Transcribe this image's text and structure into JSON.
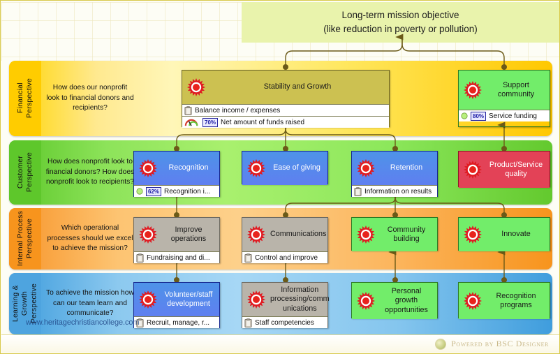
{
  "mission": {
    "line1": "Long-term mission objective",
    "line2": "(like reduction in poverty or pollution)"
  },
  "perspectives": [
    {
      "id": "financial",
      "label": "Financial\nPerspective",
      "color": "#ffcc00",
      "question": "How does our nonprofit look to financial donors and recipients?"
    },
    {
      "id": "customer",
      "label": "Customer\nPerspective",
      "color": "#5ec72b",
      "question": "How does nonprofit look to financial donors? How does nonprofit look to recipients?"
    },
    {
      "id": "internal",
      "label": "Internal Process\nPerspective",
      "color": "#f7941d",
      "question": "Which operational processes should we excel to achieve the mission?"
    },
    {
      "id": "learning",
      "label": "Learning &\nGrowth\nPerspective",
      "color": "#4ea4df",
      "question": "To achieve the mission how can our team learn and communicate?"
    }
  ],
  "objectives": [
    {
      "id": "stability-and-growth",
      "title": "Stability and Growth",
      "perspective": "financial",
      "kpis": [
        {
          "icon": "document-icon",
          "percent": null,
          "text": "Balance income / expenses"
        },
        {
          "icon": "gauge-icon",
          "percent": "70%",
          "text": "Net amount of funds raised"
        }
      ]
    },
    {
      "id": "support-community",
      "title": "Support community",
      "perspective": "financial",
      "kpis": [
        {
          "icon": "status-circle-icon",
          "percent": "80%",
          "text": "Service funding"
        }
      ]
    },
    {
      "id": "recognition",
      "title": "Recognition",
      "perspective": "customer",
      "kpis": [
        {
          "icon": "status-circle-icon",
          "percent": "62%",
          "text": "Recognition i..."
        }
      ]
    },
    {
      "id": "ease-of-giving",
      "title": "Ease of giving",
      "perspective": "customer",
      "kpis": []
    },
    {
      "id": "retention",
      "title": "Retention",
      "perspective": "customer",
      "kpis": [
        {
          "icon": "document-icon",
          "percent": null,
          "text": "Information on results"
        }
      ]
    },
    {
      "id": "product-service-quality",
      "title": "Product/Service quality",
      "perspective": "customer",
      "kpis": []
    },
    {
      "id": "improve-operations",
      "title": "Improve operations",
      "perspective": "internal",
      "kpis": [
        {
          "icon": "document-icon",
          "percent": null,
          "text": "Fundraising and di..."
        }
      ]
    },
    {
      "id": "communications",
      "title": "Communications",
      "perspective": "internal",
      "kpis": [
        {
          "icon": "document-icon",
          "percent": null,
          "text": "Control and improve"
        }
      ]
    },
    {
      "id": "community-building",
      "title": "Community building",
      "perspective": "internal",
      "kpis": []
    },
    {
      "id": "innovate",
      "title": "Innovate",
      "perspective": "internal",
      "kpis": []
    },
    {
      "id": "volunteer-staff-development",
      "title": "Volunteer/staff development",
      "perspective": "learning",
      "kpis": [
        {
          "icon": "document-icon",
          "percent": null,
          "text": "Recruit, manage, r..."
        }
      ]
    },
    {
      "id": "information-processing-communications",
      "title": "Information processing/comm unications",
      "perspective": "learning",
      "kpis": [
        {
          "icon": "document-icon",
          "percent": null,
          "text": "Staff competencies"
        }
      ]
    },
    {
      "id": "personal-growth-opportunities",
      "title": "Personal growth opportunities",
      "perspective": "learning",
      "kpis": []
    },
    {
      "id": "recognition-programs",
      "title": "Recognition programs",
      "perspective": "learning",
      "kpis": []
    }
  ],
  "watermark": "www.heritagechristiancollege.com",
  "footer": {
    "powered_by": "Powered by BSC Designer"
  },
  "colors": {
    "financial_band": "#ffcc00",
    "customer_band": "#5ec72b",
    "internal_band": "#f7941d",
    "learning_band": "#4ea4df",
    "mission_banner": "#e9f3ac",
    "connector": "#6b5a18",
    "objective_olive": "#ccc151",
    "objective_green": "#72ed6a",
    "objective_blue": "#5f7ff0",
    "objective_red": "#e34257",
    "objective_gray": "#b9b4aa",
    "sun_icon": "#e01b22"
  }
}
